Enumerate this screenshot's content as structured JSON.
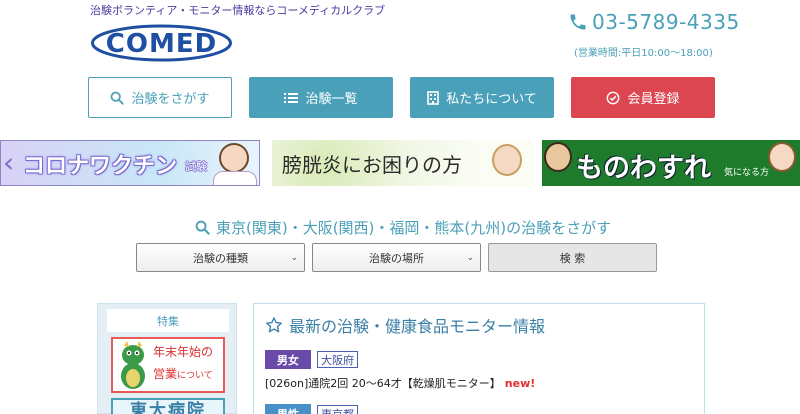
{
  "header": {
    "tagline": "治験ボランティア・モニター情報ならコーメディカルクラブ",
    "logo_text": "COMED",
    "phone": "03-5789-4335",
    "hours": "(営業時間:平日10:00～18:00)"
  },
  "nav": [
    {
      "label": "治験をさがす",
      "icon": "search-icon"
    },
    {
      "label": "治験一覧",
      "icon": "list-icon"
    },
    {
      "label": "私たちについて",
      "icon": "building-icon"
    },
    {
      "label": "会員登録",
      "icon": "check-circle-icon"
    }
  ],
  "banners": {
    "covid_text": "コロナワクチン",
    "covid_small": "試験",
    "bladder_text": "膀胱炎にお困りの方",
    "memory_text": "ものわすれ",
    "memory_small": "気になる方"
  },
  "search": {
    "title": "東京(関東)・大阪(関西)・福岡・熊本(九州)の治験をさがす",
    "type_select": "治験の種類",
    "place_select": "治験の場所",
    "button": "検 索"
  },
  "sidebar": {
    "label": "特集",
    "banner1_line1": "年末年始の",
    "banner1_line2": "営業",
    "banner1_line2_small": "について",
    "banner2": "東大病院"
  },
  "main": {
    "title": "最新の治験・健康食品モニター情報",
    "items": [
      {
        "gender": "男女",
        "place": "大阪府",
        "title": "[026on]通院2回 20～64才【乾燥肌モニター】",
        "badge": "new!"
      },
      {
        "gender": "男性",
        "place": "東京都"
      }
    ]
  },
  "colors": {
    "accent": "#4aa0b8",
    "register": "#db4650",
    "brand": "#1e4fa3"
  }
}
